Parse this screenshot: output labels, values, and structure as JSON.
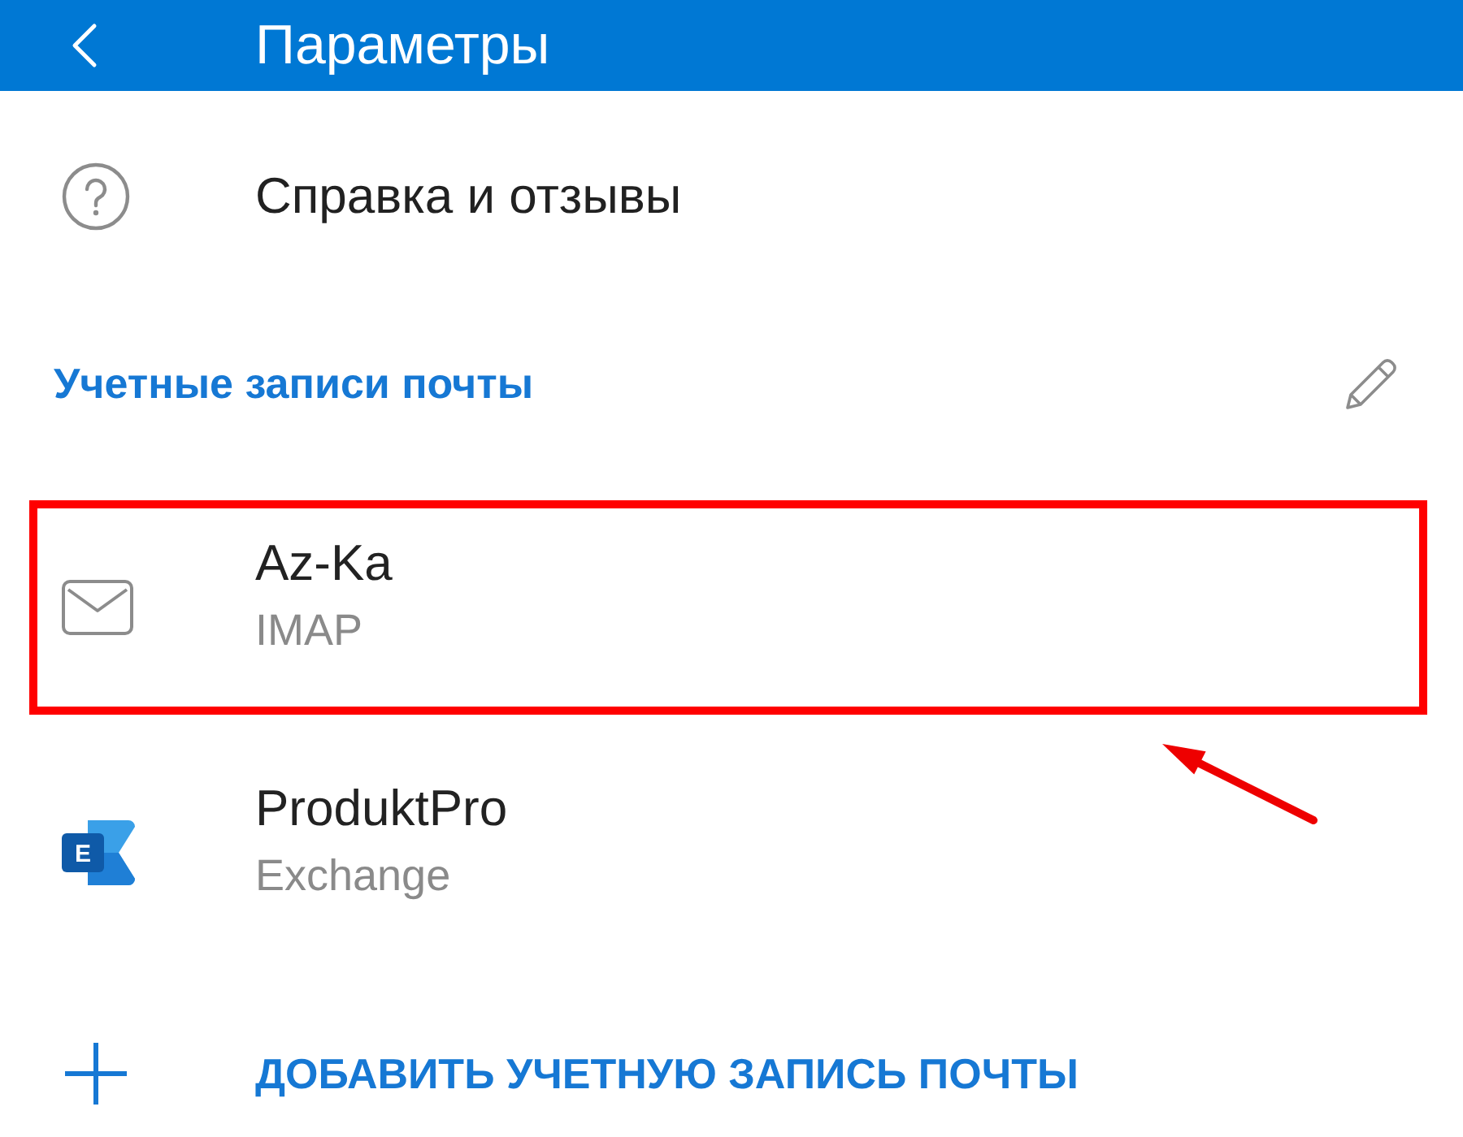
{
  "header": {
    "title": "Параметры"
  },
  "help_item": {
    "label": "Справка и отзывы"
  },
  "accounts_section": {
    "title": "Учетные записи почты"
  },
  "accounts": [
    {
      "kind": "imap",
      "name": "Az-Ka",
      "account_type": "IMAP",
      "highlighted": true
    },
    {
      "kind": "exchange",
      "name": "ProduktPro",
      "account_type": "Exchange",
      "logo_letter": "E",
      "highlighted": false
    }
  ],
  "add_account": {
    "label": "ДОБАВИТЬ УЧЕТНУЮ ЗАПИСЬ ПОЧТЫ"
  }
}
